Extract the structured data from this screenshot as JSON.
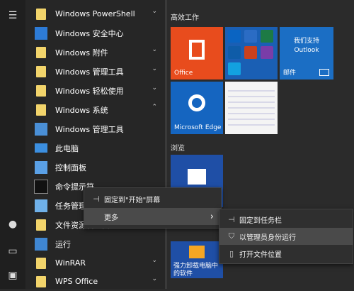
{
  "rail": {
    "menu_icon": "☰",
    "user_icon": "●",
    "doc_icon": "▭",
    "pic_icon": "▣"
  },
  "apps": [
    {
      "label": "Windows PowerShell",
      "chev": "⌄",
      "icon": "folder"
    },
    {
      "label": "Windows 安全中心",
      "chev": "",
      "icon": "shield"
    },
    {
      "label": "Windows 附件",
      "chev": "⌄",
      "icon": "folder"
    },
    {
      "label": "Windows 管理工具",
      "chev": "⌄",
      "icon": "folder"
    },
    {
      "label": "Windows 轻松使用",
      "chev": "⌄",
      "icon": "folder"
    },
    {
      "label": "Windows 系统",
      "chev": "⌃",
      "icon": "folder"
    },
    {
      "label": "Windows 管理工具",
      "chev": "",
      "icon": "tool"
    },
    {
      "label": "此电脑",
      "chev": "",
      "icon": "pc"
    },
    {
      "label": "控制面板",
      "chev": "",
      "icon": "cp"
    },
    {
      "label": "命令提示符",
      "chev": "",
      "icon": "cmd"
    },
    {
      "label": "任务管理器",
      "chev": "",
      "icon": "task"
    },
    {
      "label": "文件资源管理器",
      "chev": "",
      "icon": "folder"
    },
    {
      "label": "运行",
      "chev": "",
      "icon": "run"
    },
    {
      "label": "WinRAR",
      "chev": "⌄",
      "icon": "folder"
    },
    {
      "label": "WPS Office",
      "chev": "⌄",
      "icon": "folder"
    }
  ],
  "sections": {
    "work": "高效工作",
    "browse": "浏览"
  },
  "tiles": {
    "office": "Office",
    "mail_title": "我们支持 Outlook",
    "mail": "邮件",
    "edge": "Microsoft Edge",
    "store_promo": "强力卸载电脑中的软件"
  },
  "context_menu": {
    "pin_start": "固定到\"开始\"屏幕",
    "more": "更多",
    "more_arrow": "›"
  },
  "sub_menu": {
    "pin_taskbar": "固定到任务栏",
    "run_admin": "以管理员身份运行",
    "open_location": "打开文件位置"
  }
}
